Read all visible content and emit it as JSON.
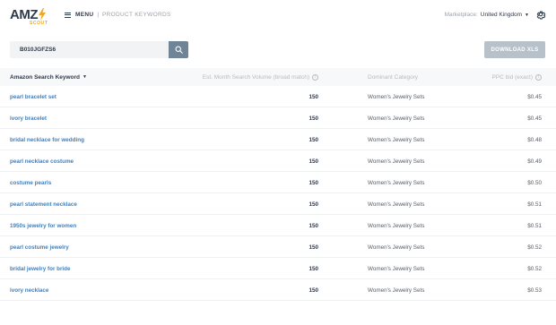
{
  "header": {
    "logo_text": "AMZ",
    "logo_sub": "SCOUT",
    "menu_label": "MENU",
    "separator": "|",
    "section_title": "PRODUCT KEYWORDS",
    "marketplace_label": "Marketplace:",
    "marketplace_value": "United Kingdom",
    "brand_color": "#f5a623"
  },
  "search": {
    "value": "B010JGFZS6",
    "icon": "search-icon"
  },
  "toolbar": {
    "download_label": "DOWNLOAD XLS"
  },
  "table": {
    "columns": {
      "keyword": "Amazon Search Keyword",
      "volume": "Est. Month Search Volume (broad match)",
      "category": "Dominant Category",
      "ppc": "PPC bid (exact)"
    },
    "rows": [
      {
        "keyword": "pearl bracelet set",
        "volume": "150",
        "category": "Women's Jewelry Sets",
        "ppc": "$0.45"
      },
      {
        "keyword": "ivory bracelet",
        "volume": "150",
        "category": "Women's Jewelry Sets",
        "ppc": "$0.45"
      },
      {
        "keyword": "bridal necklace for wedding",
        "volume": "150",
        "category": "Women's Jewelry Sets",
        "ppc": "$0.48"
      },
      {
        "keyword": "pearl necklace costume",
        "volume": "150",
        "category": "Women's Jewelry Sets",
        "ppc": "$0.49"
      },
      {
        "keyword": "costume pearls",
        "volume": "150",
        "category": "Women's Jewelry Sets",
        "ppc": "$0.50"
      },
      {
        "keyword": "pearl statement necklace",
        "volume": "150",
        "category": "Women's Jewelry Sets",
        "ppc": "$0.51"
      },
      {
        "keyword": "1950s jewelry for women",
        "volume": "150",
        "category": "Women's Jewelry Sets",
        "ppc": "$0.51"
      },
      {
        "keyword": "pearl costume jewelry",
        "volume": "150",
        "category": "Women's Jewelry Sets",
        "ppc": "$0.52"
      },
      {
        "keyword": "bridal jewelry for bride",
        "volume": "150",
        "category": "Women's Jewelry Sets",
        "ppc": "$0.52"
      },
      {
        "keyword": "ivory necklace",
        "volume": "150",
        "category": "Women's Jewelry Sets",
        "ppc": "$0.53"
      }
    ]
  }
}
